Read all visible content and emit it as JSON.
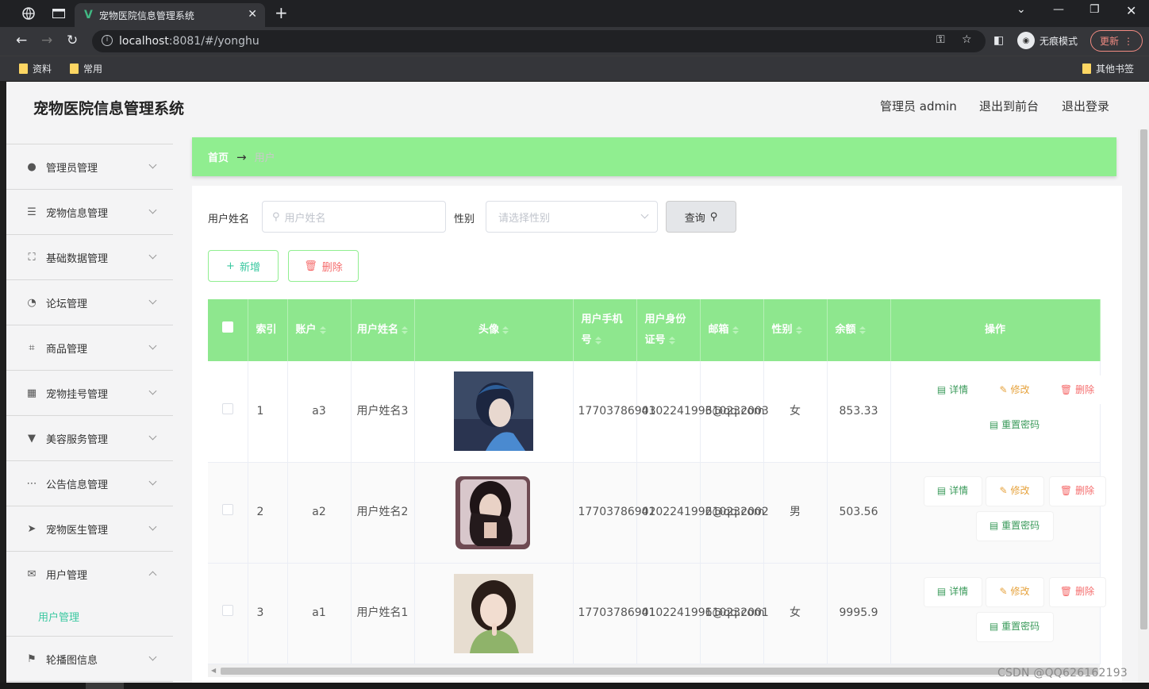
{
  "browser": {
    "tab_title": "宠物医院信息管理系统",
    "url_host": "localhost",
    "url_rest": ":8081/#/yonghu",
    "incognito_label": "无痕模式",
    "update_label": "更新",
    "bookmarks": [
      "资料",
      "常用"
    ],
    "other_bookmarks": "其他书签"
  },
  "header": {
    "title": "宠物医院信息管理系统",
    "admin_label": "管理员 admin",
    "to_front": "退出到前台",
    "logout": "退出登录"
  },
  "sidebar": {
    "items": [
      {
        "label": "管理员管理",
        "icon": "lightbulb-icon"
      },
      {
        "label": "宠物信息管理",
        "icon": "list-icon"
      },
      {
        "label": "基础数据管理",
        "icon": "fullscreen-icon"
      },
      {
        "label": "论坛管理",
        "icon": "compass-icon"
      },
      {
        "label": "商品管理",
        "icon": "crop-icon"
      },
      {
        "label": "宠物挂号管理",
        "icon": "grid-icon"
      },
      {
        "label": "美容服务管理",
        "icon": "brush-icon"
      },
      {
        "label": "公告信息管理",
        "icon": "chat-dots-icon"
      },
      {
        "label": "宠物医生管理",
        "icon": "send-icon"
      },
      {
        "label": "用户管理",
        "icon": "mail-icon"
      },
      {
        "label": "轮播图信息",
        "icon": "flag-icon"
      }
    ],
    "sub_item": "用户管理"
  },
  "breadcrumb": {
    "home": "首页",
    "arrow": "→",
    "current": "用户"
  },
  "search": {
    "name_label": "用户姓名",
    "name_placeholder": "用户姓名",
    "gender_label": "性别",
    "gender_placeholder": "请选择性别",
    "query_label": "查询"
  },
  "actions": {
    "add": "新增",
    "delete": "删除"
  },
  "table": {
    "headers": {
      "index": "索引",
      "account": "账户",
      "name": "用户姓名",
      "avatar": "头像",
      "phone": "用户手机号",
      "idcard": "用户身份证号",
      "email": "邮箱",
      "gender": "性别",
      "balance": "余额",
      "ops": "操作"
    },
    "rows": [
      {
        "index": "1",
        "account": "a3",
        "name": "用户姓名3",
        "phone": "17703786903",
        "idcard": "410224199610232003",
        "email": "3@qq.com",
        "gender": "女",
        "balance": "853.33"
      },
      {
        "index": "2",
        "account": "a2",
        "name": "用户姓名2",
        "phone": "17703786902",
        "idcard": "410224199610232002",
        "email": "2@qq.com",
        "gender": "男",
        "balance": "503.56"
      },
      {
        "index": "3",
        "account": "a1",
        "name": "用户姓名1",
        "phone": "17703786901",
        "idcard": "410224199610232001",
        "email": "1@qq.com",
        "gender": "女",
        "balance": "9995.9"
      }
    ],
    "op_labels": {
      "detail": "详情",
      "edit": "修改",
      "delete": "删除",
      "reset": "重置密码"
    }
  },
  "watermark": "CSDN @QQ626162193",
  "colors": {
    "accent_green": "#90ee90",
    "header_green": "#8ee78e",
    "teal": "#3ac8a0",
    "danger": "#f56c6c",
    "warning": "#e6a23c"
  }
}
